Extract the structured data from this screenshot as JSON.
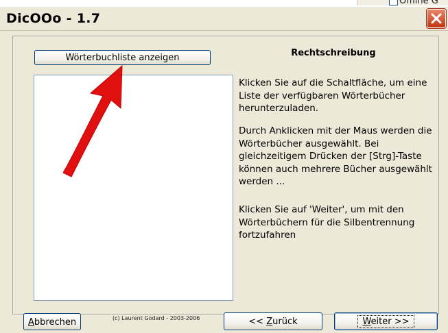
{
  "background_window": {
    "checkbox_label": "Offline G"
  },
  "window": {
    "title": "DicOOo - 1.7"
  },
  "wordlist": {
    "button_label": "Wörterbuchliste anzeigen"
  },
  "info": {
    "heading": "Rechtschreibung",
    "paragraph1": "Klicken Sie auf die Schaltfläche, um eine Liste der verfügbaren Wörterbücher herunterzuladen.",
    "paragraph2": "Durch Anklicken mit der Maus werden die Wörterbücher ausgewählt. Bei gleichzeitigem Drücken der [Strg]-Taste können auch mehrere Bücher ausgewählt werden ...",
    "paragraph3": "Klicken Sie auf 'Weiter', um mit den Wörterbüchern für die Silbentrennung fortzufahren"
  },
  "footer": {
    "credit": "(c) Laurent Godard - 2003-2006",
    "cancel": {
      "first": "A",
      "rest": "bbrechen"
    },
    "back": {
      "prefix": "<< ",
      "first": "Z",
      "rest": "urück"
    },
    "next": {
      "first": "W",
      "rest": "eiter >>"
    }
  },
  "colors": {
    "annotation_arrow": "#e01010",
    "close_button": "#d9461d"
  },
  "icons": {
    "close": "close-icon",
    "annotation": "red-arrow-annotation"
  }
}
